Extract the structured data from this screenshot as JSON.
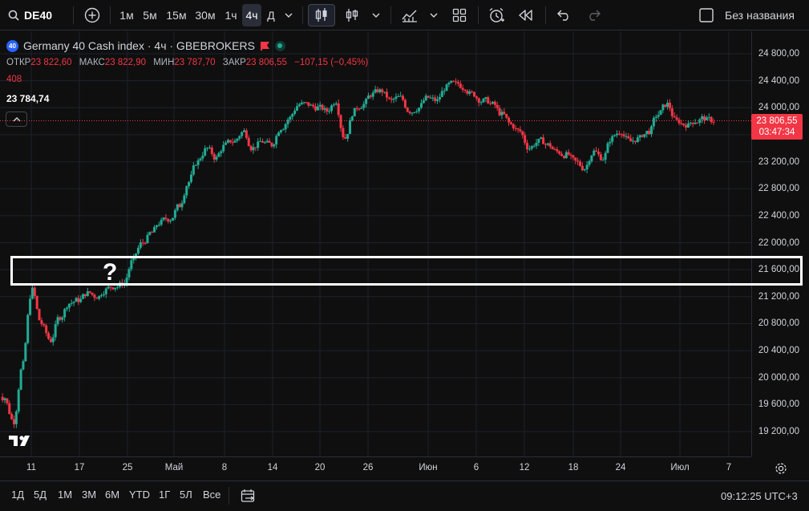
{
  "toolbar": {
    "symbol": "DE40",
    "intervals": [
      "1м",
      "5м",
      "15м",
      "30м",
      "1ч",
      "4ч",
      "Д"
    ],
    "active_interval": "4ч",
    "layout_name": "Без названия"
  },
  "legend": {
    "badge": "40",
    "title": "Germany 40 Cash index · 4ч · GBEBROKERS",
    "open_label": "ОТКР",
    "open_value": "23 822,60",
    "high_label": "МАКС",
    "high_value": "23 822,90",
    "low_label": "МИН",
    "low_value": "23 787,70",
    "close_label": "ЗАКР",
    "close_value": "23 806,55",
    "change": "−107,15 (−0,45%)",
    "volume": "408",
    "cursor_price": "23 784,74"
  },
  "price_axis": {
    "labels": [
      "24 800,00",
      "24 400,00",
      "24 000,00",
      "23 600,00",
      "23 200,00",
      "22 800,00",
      "22 400,00",
      "22 000,00",
      "21 600,00",
      "21 200,00",
      "20 800,00",
      "20 400,00",
      "20 000,00",
      "19 600,00",
      "19 200,00"
    ],
    "values": [
      24800,
      24400,
      24000,
      23600,
      23200,
      22800,
      22400,
      22000,
      21600,
      21200,
      20800,
      20400,
      20000,
      19600,
      19200
    ],
    "last_price": "23 806,55",
    "countdown": "03:47:34",
    "last_value": 23806.55
  },
  "time_axis": {
    "labels": [
      "11",
      "17",
      "25",
      "Май",
      "8",
      "14",
      "20",
      "26",
      "Июн",
      "6",
      "12",
      "18",
      "24",
      "Июл",
      "7"
    ]
  },
  "overlay": {
    "mark": "?"
  },
  "bottom": {
    "ranges": [
      "1Д",
      "5Д",
      "1М",
      "3М",
      "6М",
      "YTD",
      "1Г",
      "5Л",
      "Все"
    ],
    "clock": "09:12:25 UTC+3"
  },
  "colors": {
    "up": "#22ab94",
    "down": "#f23645",
    "background": "#0f0f0f",
    "grid": "#1e222d"
  },
  "chart_data": {
    "type": "candlestick",
    "title": "Germany 40 Cash index · 4ч · GBEBROKERS",
    "ylim": [
      19000,
      25000
    ],
    "x": [
      "11",
      "17",
      "25",
      "Май",
      "8",
      "14",
      "20",
      "26",
      "Июн",
      "6",
      "12",
      "18",
      "24",
      "Июл",
      "7"
    ],
    "series": [
      {
        "name": "DE40",
        "close": [
          19700,
          19350,
          20200,
          21300,
          20800,
          20550,
          20900,
          21100,
          21150,
          21250,
          21200,
          21300,
          21350,
          21400,
          21750,
          22000,
          22150,
          22300,
          22350,
          22550,
          22900,
          23200,
          23400,
          23250,
          23450,
          23500,
          23650,
          23400,
          23500,
          23450,
          23700,
          23850,
          24050,
          24050,
          24000,
          23950,
          24100,
          23550,
          23950,
          24050,
          24200,
          24250,
          24100,
          24150,
          23950,
          24000,
          24150,
          24100,
          24300,
          24350,
          24300,
          24200,
          24100,
          24050,
          23900,
          23750,
          23650,
          23400,
          23500,
          23450,
          23350,
          23300,
          23200,
          23100,
          23350,
          23250,
          23550,
          23650,
          23500,
          23550,
          23650,
          23900,
          24050,
          23800,
          23750,
          23800,
          23850,
          23806.55
        ]
      }
    ]
  }
}
